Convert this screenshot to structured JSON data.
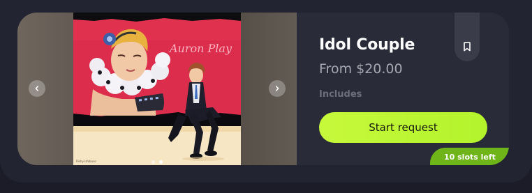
{
  "listing": {
    "title": "Idol Couple",
    "price": "From $20.00",
    "includes_label": "Includes",
    "cta_label": "Start request",
    "slots_badge": "10 slots left"
  },
  "gallery": {
    "artwork_text": "Auron Play",
    "artist_signature": "Rishy Ishibuso",
    "slide_count": 2,
    "active_slide": 2,
    "prev_icon": "chevron-left-icon",
    "next_icon": "chevron-right-icon"
  },
  "icons": {
    "bookmark": "bookmark-icon"
  },
  "colors": {
    "background": "#1b1c27",
    "card": "#232431",
    "listing": "#2a2b38",
    "accent_green": "#c6f93b",
    "badge_green": "#6fb51a",
    "title_text": "#ffffff",
    "muted_text": "#a7a8b2"
  }
}
